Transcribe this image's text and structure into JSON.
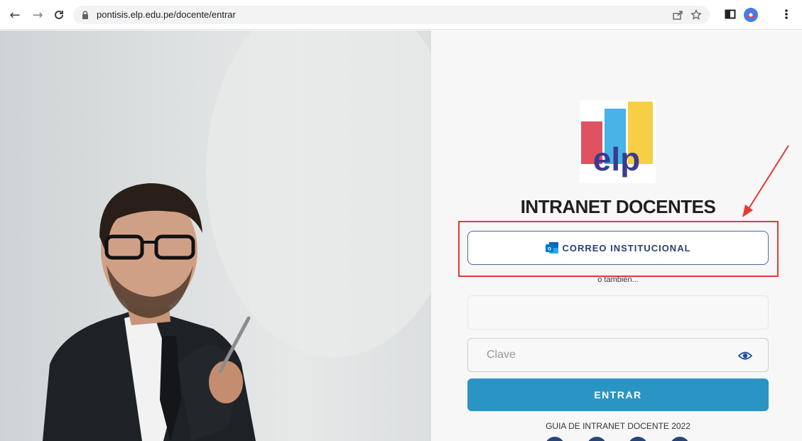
{
  "browser": {
    "url": "pontisis.elp.edu.pe/docente/entrar"
  },
  "login": {
    "logo_text": "elp",
    "title": "INTRANET DOCENTES",
    "outlook_button_label": "CORREO INSTITUCIONAL",
    "or_text": "o también...",
    "username_placeholder": "",
    "password_placeholder": "Clave",
    "submit_label": "ENTRAR",
    "guide_link": "GUIA DE INTRANET DOCENTE 2022"
  },
  "colors": {
    "submit": "#2a95c5",
    "highlight": "#e53935",
    "logo_red": "#e05260",
    "logo_blue": "#46b4e6",
    "logo_yellow": "#f6cf45",
    "logo_text": "#3c3a8e"
  }
}
